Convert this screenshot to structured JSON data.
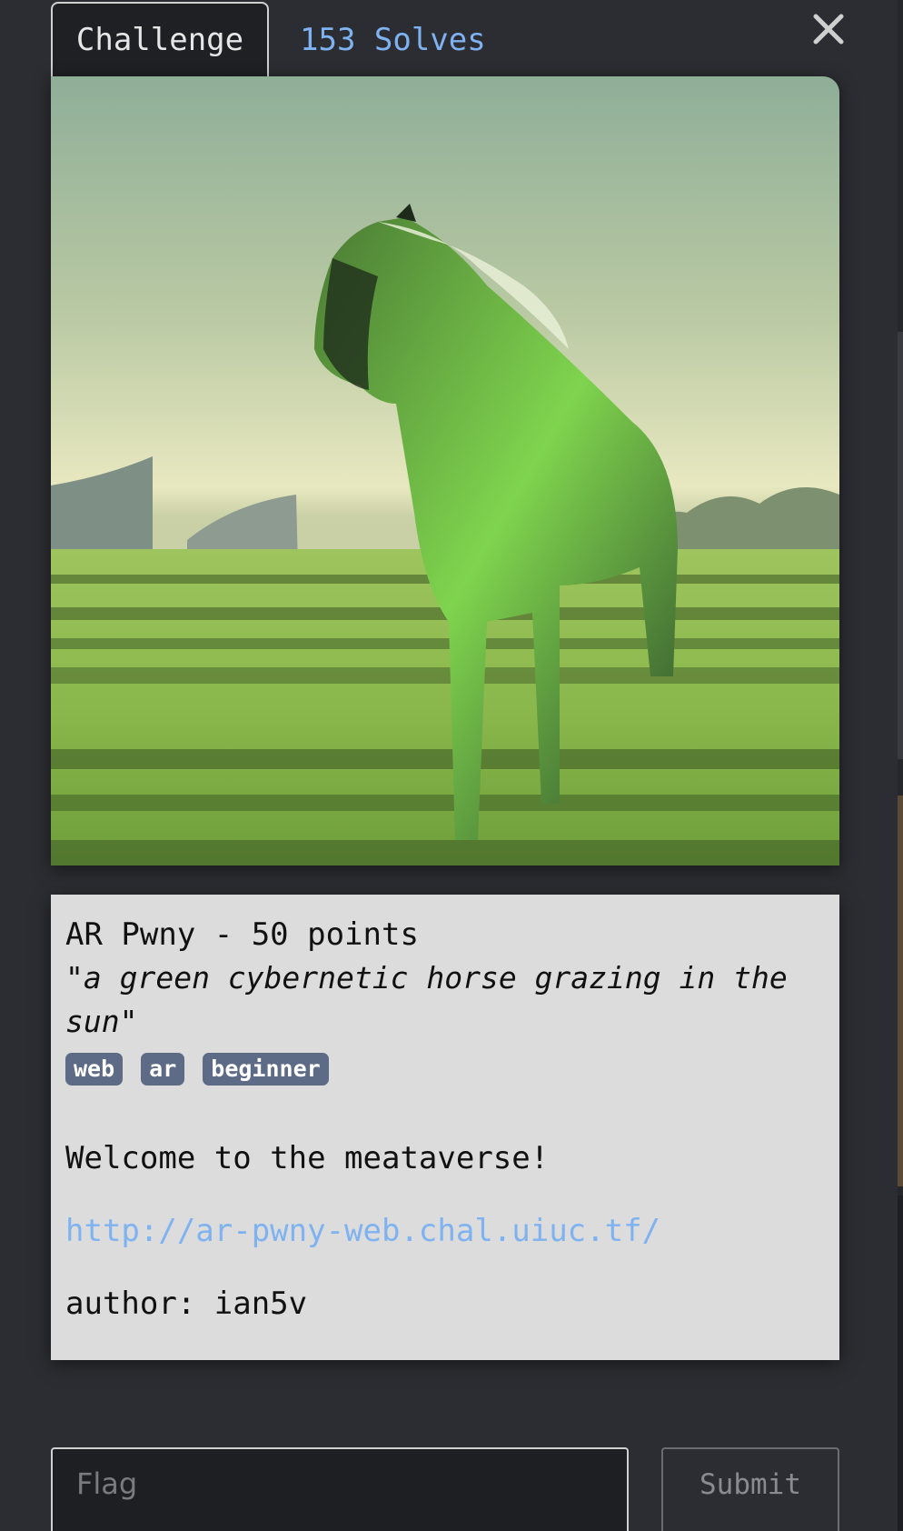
{
  "tabs": {
    "challenge_label": "Challenge",
    "solves_label": "153 Solves"
  },
  "close_icon": "close-icon",
  "image": {
    "alt": "a green cybernetic horse grazing in the sun"
  },
  "challenge": {
    "title": "AR Pwny - 50 points",
    "quote": "\"a green cybernetic horse grazing in the sun\"",
    "tags": [
      "web",
      "ar",
      "beginner"
    ],
    "description": "Welcome to the meataverse!",
    "link": "http://ar-pwny-web.chal.uiuc.tf/",
    "author": "author: ian5v"
  },
  "flag_form": {
    "placeholder": "Flag",
    "submit_label": "Submit"
  },
  "colors": {
    "background": "#2c2d32",
    "card": "#dcdcdc",
    "link": "#7fb2f0",
    "tag": "#5e6b87"
  }
}
